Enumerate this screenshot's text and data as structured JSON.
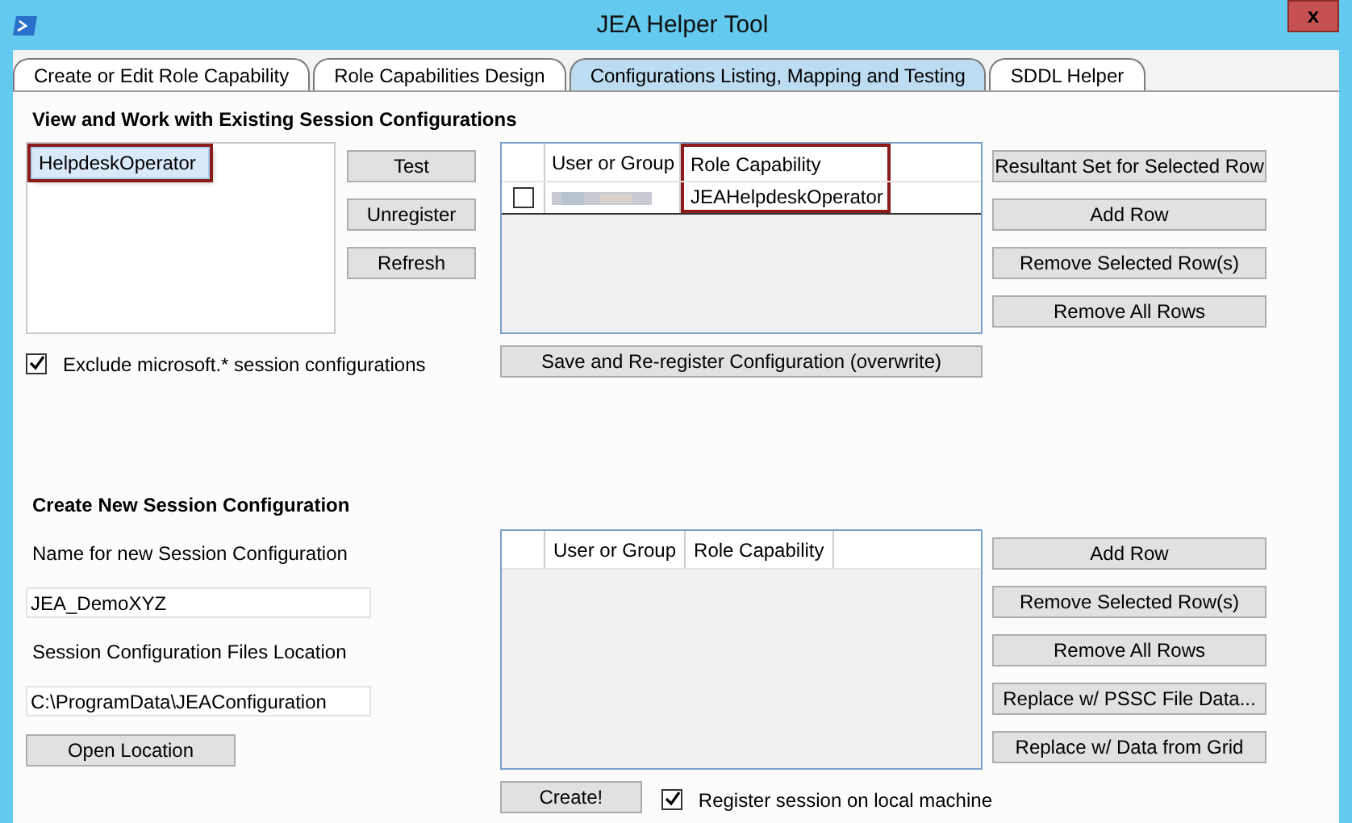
{
  "window": {
    "title": "JEA Helper Tool",
    "close": "x"
  },
  "tabs": [
    {
      "label": "Create or Edit Role Capability",
      "selected": false
    },
    {
      "label": "Role Capabilities Design",
      "selected": false
    },
    {
      "label": "Configurations Listing, Mapping and Testing",
      "selected": true
    },
    {
      "label": "SDDL Helper",
      "selected": false
    }
  ],
  "existing": {
    "heading": "View and Work with Existing Session Configurations",
    "configurations": [
      {
        "label": "HelpdeskOperator",
        "selected": true,
        "highlighted": true
      }
    ],
    "buttons": [
      "Test",
      "Unregister",
      "Refresh"
    ],
    "grid": {
      "columns": [
        {
          "label": "User or Group",
          "highlighted": false
        },
        {
          "label": "Role Capability",
          "highlighted": true
        }
      ],
      "rows": [
        {
          "checked": false,
          "redacted": true,
          "role_capability": "JEAHelpdeskOperator"
        }
      ]
    },
    "grid_buttons": [
      "Resultant Set for Selected Row",
      "Add Row",
      "Remove Selected Row(s)",
      "Remove All Rows"
    ],
    "save_button": "Save and Re-register Configuration (overwrite)",
    "exclude": {
      "label": "Exclude microsoft.* session configurations",
      "checked": true
    }
  },
  "create": {
    "heading": "Create New Session Configuration",
    "name_label": "Name for new Session Configuration",
    "name_value": "JEA_DemoXYZ",
    "location_label": "Session Configuration Files Location",
    "location_value": "C:\\ProgramData\\JEAConfiguration",
    "open_button": "Open Location",
    "grid": {
      "columns": [
        {
          "label": "User or Group",
          "highlighted": false
        },
        {
          "label": "Role Capability",
          "highlighted": false
        }
      ]
    },
    "grid_buttons": [
      "Add Row",
      "Remove Selected Row(s)",
      "Remove All Rows",
      "Replace w/ PSSC File Data...",
      "Replace w/ Data from Grid"
    ],
    "create_button": "Create!",
    "register": {
      "label": "Register session on local machine",
      "checked": true
    }
  }
}
